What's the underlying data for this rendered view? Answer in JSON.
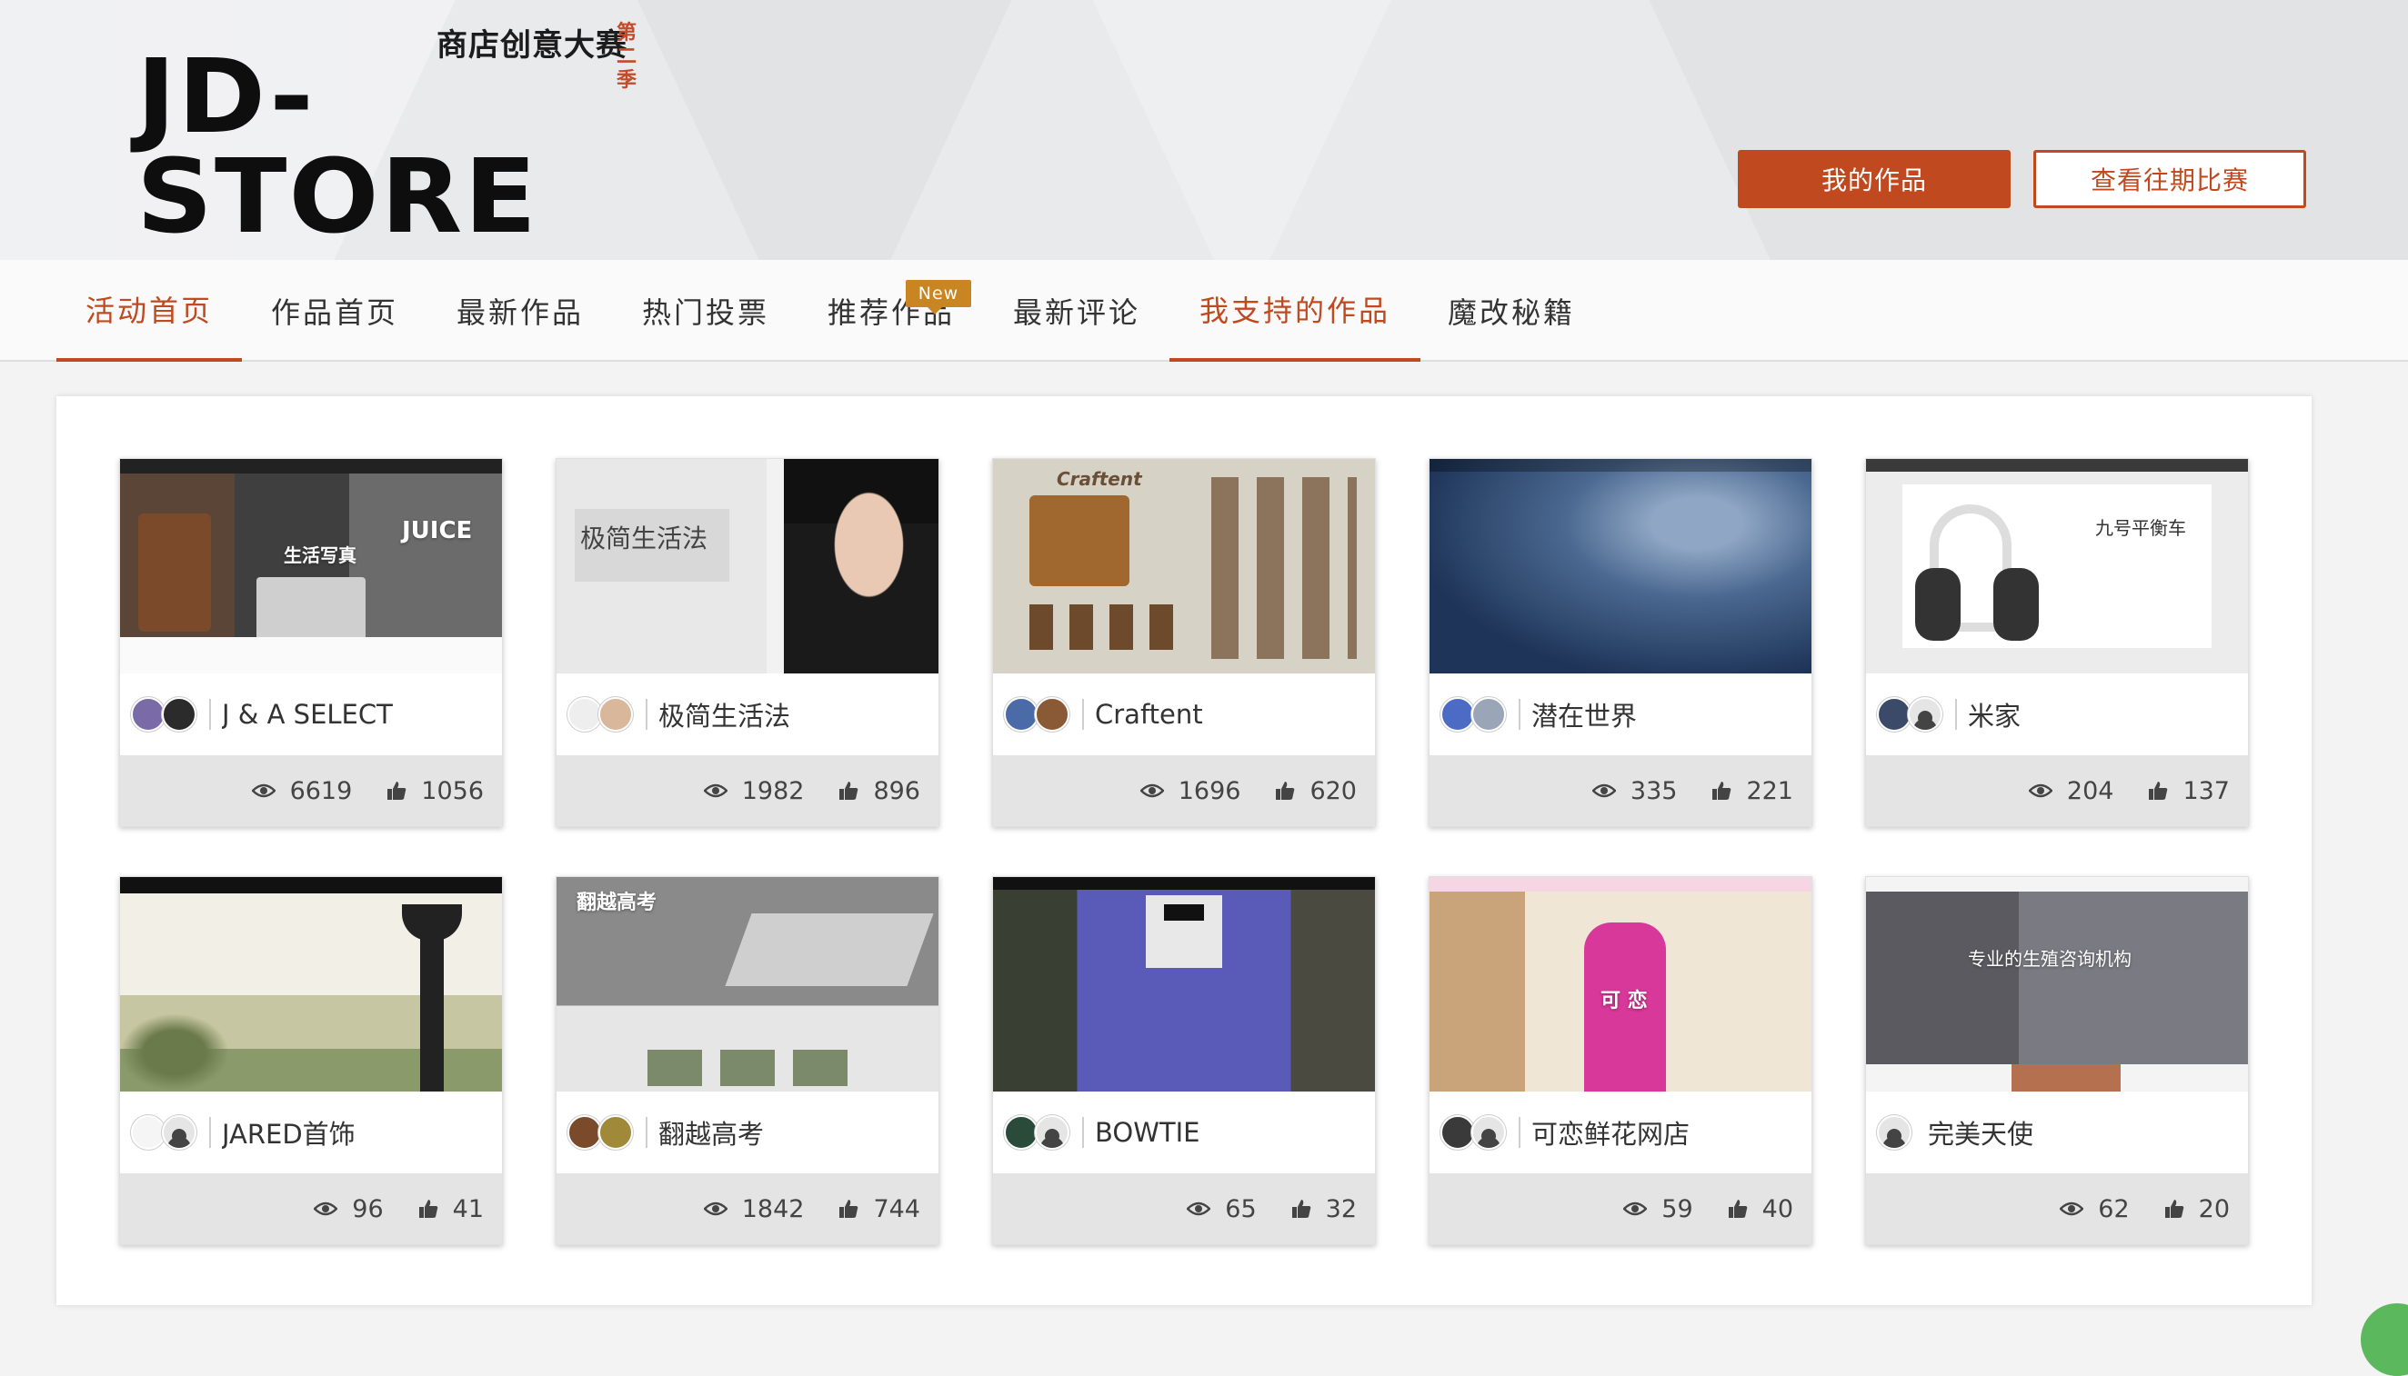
{
  "header": {
    "logo_main": "JD-STORE",
    "logo_subtitle": "商店创意大赛",
    "logo_season": "第二季",
    "my_works_button": "我的作品",
    "past_contests_button": "查看往期比赛"
  },
  "nav": {
    "items": [
      {
        "label": "活动首页",
        "active": true
      },
      {
        "label": "作品首页",
        "active": false
      },
      {
        "label": "最新作品",
        "active": false
      },
      {
        "label": "热门投票",
        "active": false
      },
      {
        "label": "推荐作品",
        "active": false
      },
      {
        "label": "最新评论",
        "active": false
      },
      {
        "label": "我支持的作品",
        "active": true
      },
      {
        "label": "魔改秘籍",
        "active": false
      }
    ],
    "badge": "New"
  },
  "cards": [
    {
      "title": "J & A SELECT",
      "views": "6619",
      "likes": "1056",
      "thumb_text": "生活写真",
      "thumb_text2": "JUICE"
    },
    {
      "title": "极简生活法",
      "views": "1982",
      "likes": "896",
      "thumb_text": "极简生活法",
      "thumb_text2": ""
    },
    {
      "title": "Craftent",
      "views": "1696",
      "likes": "620",
      "thumb_text": "Craftent",
      "thumb_text2": ""
    },
    {
      "title": "潜在世界",
      "views": "335",
      "likes": "221",
      "thumb_text": "",
      "thumb_text2": ""
    },
    {
      "title": "米家",
      "views": "204",
      "likes": "137",
      "thumb_text": "九号平衡车",
      "thumb_text2": ""
    },
    {
      "title": "JARED首饰",
      "views": "96",
      "likes": "41",
      "thumb_text": "",
      "thumb_text2": ""
    },
    {
      "title": "翻越高考",
      "views": "1842",
      "likes": "744",
      "thumb_text": "翻越高考",
      "thumb_text2": ""
    },
    {
      "title": "BOWTIE",
      "views": "65",
      "likes": "32",
      "thumb_text": "",
      "thumb_text2": ""
    },
    {
      "title": "可恋鲜花网店",
      "views": "59",
      "likes": "40",
      "thumb_text": "可 恋",
      "thumb_text2": ""
    },
    {
      "title": "完美天使",
      "views": "62",
      "likes": "20",
      "thumb_text": "专业的生殖咨询机构",
      "thumb_text2": ""
    }
  ],
  "colors": {
    "accent": "#c1491f",
    "badge": "#c98522",
    "stats_bg": "#e4e4e4"
  },
  "icons": {
    "views": "eye-icon",
    "likes": "thumbs-up-icon"
  }
}
